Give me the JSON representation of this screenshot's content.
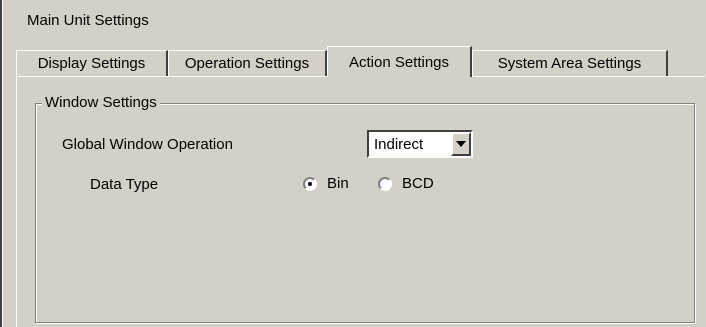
{
  "window": {
    "title": "Main Unit Settings"
  },
  "tabs": [
    {
      "label": "Display Settings",
      "active": false
    },
    {
      "label": "Operation Settings",
      "active": false
    },
    {
      "label": "Action Settings",
      "active": true
    },
    {
      "label": "System Area Settings",
      "active": false
    }
  ],
  "window_settings": {
    "group_title": "Window Settings",
    "global_window_operation": {
      "label": "Global Window Operation",
      "value": "Indirect"
    },
    "data_type": {
      "label": "Data Type",
      "options": [
        {
          "label": "Bin",
          "selected": true
        },
        {
          "label": "BCD",
          "selected": false
        }
      ]
    }
  }
}
